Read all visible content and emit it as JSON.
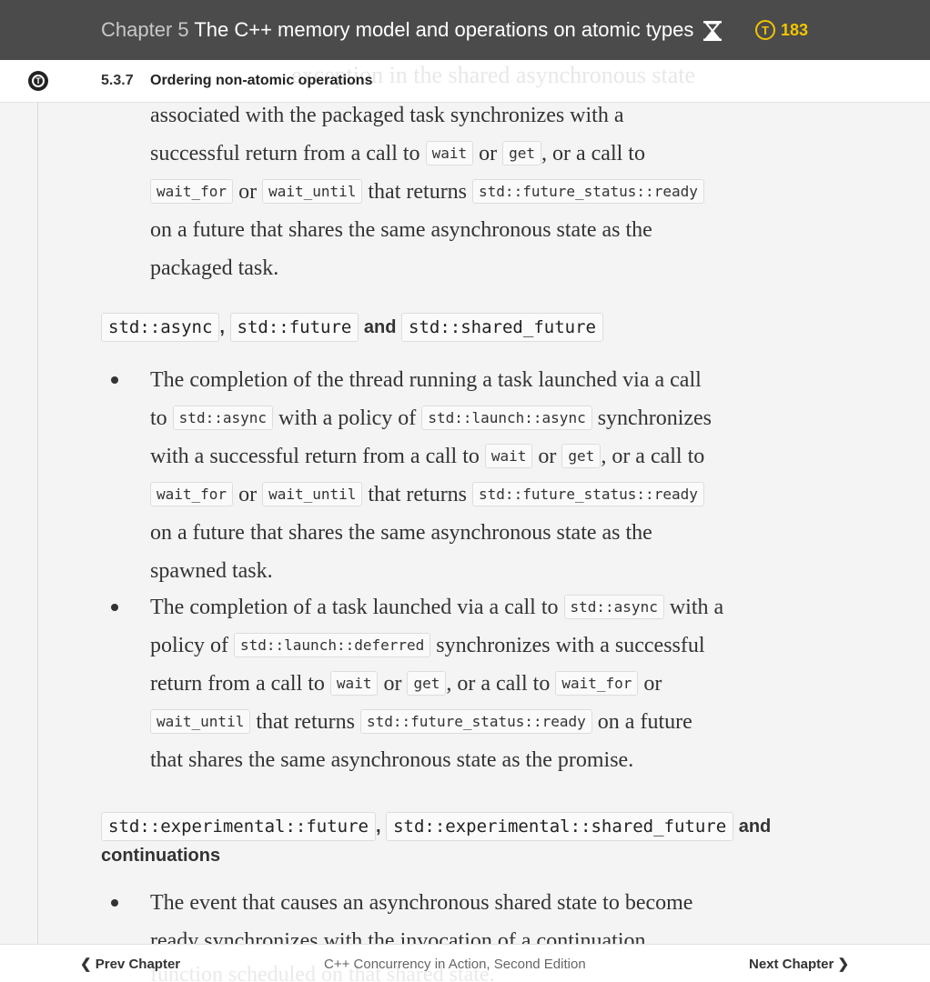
{
  "header": {
    "chapter_num": "Chapter 5",
    "chapter_title": "The C++ memory model and operations on atomic types",
    "token_count": "183",
    "token_letter": "T"
  },
  "section": {
    "number": "5.3.7",
    "title": "Ordering non-atomic operations",
    "ghost": "exception in the shared asynchronous state"
  },
  "para1": {
    "l1": "associated with the packaged task synchronizes with a",
    "l2_a": "successful return from a call to ",
    "l2_wait": "wait",
    "l2_or": " or ",
    "l2_get": "get",
    "l2_b": ", or a call to",
    "l3_waitfor": "wait_for",
    "l3_or": " or ",
    "l3_waituntil": "wait_until",
    "l3_a": " that returns ",
    "l3_ready": "std::future_status::ready",
    "l4": "on a future that shares the same asynchronous state as the",
    "l5": "packaged task."
  },
  "heading1": {
    "c1": "std::async",
    "comma": ",",
    "c2": "std::future",
    "and": "and",
    "c3": "std::shared_future"
  },
  "bullet1": {
    "l1": "The completion of the thread running a task launched via a call",
    "l2_to": "to ",
    "l2_async": "std::async",
    "l2_a": " with a policy of ",
    "l2_launch": "std::launch::async",
    "l2_b": " synchronizes",
    "l3_a": "with a successful return from a call to ",
    "l3_wait": "wait",
    "l3_or": " or ",
    "l3_get": "get",
    "l3_b": ", or a call to",
    "l4_waitfor": "wait_for",
    "l4_or": " or ",
    "l4_waituntil": "wait_until",
    "l4_a": " that returns ",
    "l4_ready": "std::future_status::ready",
    "l5": "on a future that shares the same asynchronous state as the",
    "l6": "spawned task."
  },
  "bullet2": {
    "l1_a": "The completion of a task launched via a call to ",
    "l1_async": "std::async",
    "l1_b": " with a",
    "l2_a": "policy of ",
    "l2_deferred": "std::launch::deferred",
    "l2_b": " synchronizes with a successful",
    "l3_a": "return from a call to ",
    "l3_wait": "wait",
    "l3_or": " or ",
    "l3_get": "get",
    "l3_b": ", or a call to ",
    "l3_waitfor": "wait_for",
    "l3_or2": " or",
    "l4_waituntil": "wait_until",
    "l4_a": " that returns ",
    "l4_ready": "std::future_status::ready",
    "l4_b": " on a future",
    "l5": "that shares the same asynchronous state as the promise."
  },
  "heading2": {
    "c1": "std::experimental::future",
    "comma": ",",
    "c2": "std::experimental::shared_future",
    "and": "and",
    "line2": "continuations"
  },
  "bullet3": {
    "l1": "The event that causes an asynchronous shared state to become",
    "l2": "ready synchronizes with the invocation of a continuation"
  },
  "footer": {
    "prev": "Prev Chapter",
    "book": "C++ Concurrency in Action, Second Edition",
    "next": "Next Chapter",
    "ghost": "function scheduled on that shared state."
  }
}
